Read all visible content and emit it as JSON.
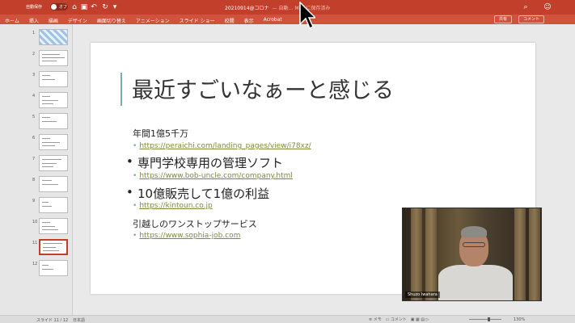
{
  "titlebar": {
    "autosave_label": "自動保存",
    "autosave_state": "オフ",
    "doc_name": "20210914@コロナ",
    "doc_status": "— 自動… Mac に保存済み"
  },
  "ribbon": {
    "tabs": [
      "ホーム",
      "挿入",
      "描画",
      "デザイン",
      "画面切り替え",
      "アニメーション",
      "スライド ショー",
      "校閲",
      "表示",
      "Acrobat"
    ],
    "share": "共有",
    "comment": "コメント"
  },
  "thumbnails": [
    "1",
    "2",
    "3",
    "4",
    "5",
    "6",
    "7",
    "8",
    "9",
    "10",
    "11",
    "12"
  ],
  "slide": {
    "title": "最近すごいなぁーと感じる",
    "items": [
      {
        "text": "年間1億5千万",
        "link": "https://peraichi.com/landing_pages/view/i78xz/"
      },
      {
        "text": "専門学校専用の管理ソフト",
        "link": "https://www.bob-uncle.com/company.html"
      },
      {
        "text": "10億販売して1億の利益",
        "link": "https://kintoun.co.jp"
      },
      {
        "text": "引越しのワンストップサービス",
        "link": "https://www.sophia-job.com"
      }
    ],
    "bullet": "•"
  },
  "video": {
    "name": "Shuzo Iwahara"
  },
  "statusbar": {
    "slide_info": "スライド 11 / 12",
    "language": "日本語",
    "notes": "メモ",
    "comments": "コメント",
    "zoom": "130%"
  }
}
